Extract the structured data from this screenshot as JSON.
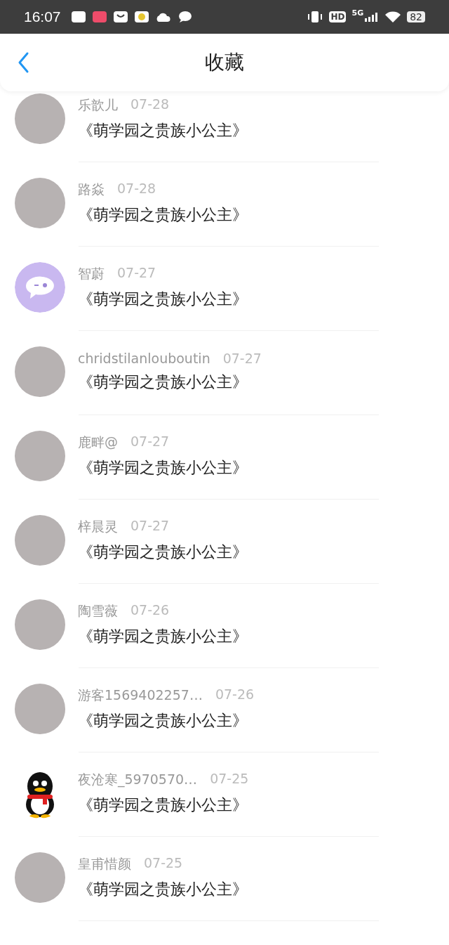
{
  "status_bar": {
    "time": "16:07",
    "network": "5G",
    "hd": "HD",
    "battery": "82"
  },
  "header": {
    "title": "收藏"
  },
  "items": [
    {
      "kind": "photo",
      "name": "乐歆儿",
      "date": "07-28",
      "title": "《萌学园之贵族小公主》"
    },
    {
      "kind": "photo",
      "name": "路焱",
      "date": "07-28",
      "title": "《萌学园之贵族小公主》"
    },
    {
      "kind": "bubble",
      "name": "智蔚",
      "date": "07-27",
      "title": "《萌学园之贵族小公主》"
    },
    {
      "kind": "photo",
      "name": "chridstilanlouboutin",
      "date": "07-27",
      "title": "《萌学园之贵族小公主》"
    },
    {
      "kind": "photo",
      "name": "鹿畔@",
      "date": "07-27",
      "title": "《萌学园之贵族小公主》"
    },
    {
      "kind": "photo",
      "name": "梓晨灵",
      "date": "07-27",
      "title": "《萌学园之贵族小公主》"
    },
    {
      "kind": "photo",
      "name": "陶雪薇",
      "date": "07-26",
      "title": "《萌学园之贵族小公主》"
    },
    {
      "kind": "photo",
      "name": "游客1569402257…",
      "date": "07-26",
      "title": "《萌学园之贵族小公主》"
    },
    {
      "kind": "penguin",
      "name": "夜沧寒_5970570…",
      "date": "07-25",
      "title": "《萌学园之贵族小公主》"
    },
    {
      "kind": "photo",
      "name": "皇甫惜颜",
      "date": "07-25",
      "title": "《萌学园之贵族小公主》"
    }
  ]
}
